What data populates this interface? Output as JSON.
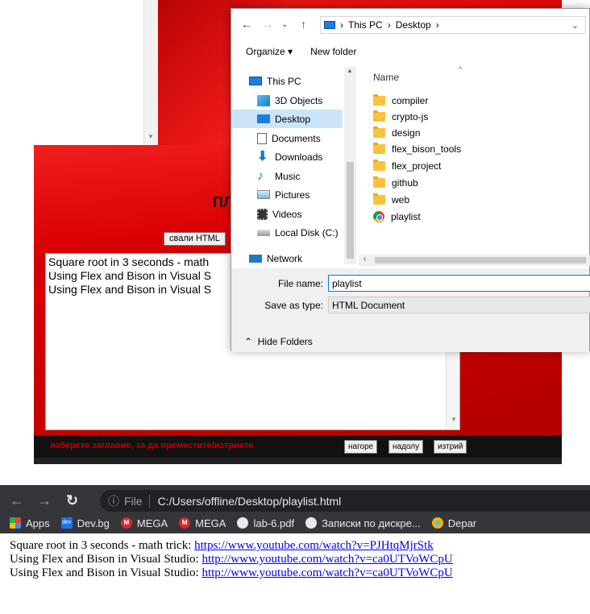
{
  "app": {
    "title_fragment": "ПЛ",
    "load_html_button": "свали HTML",
    "textarea_lines": [
      "Square root in 3 seconds - math",
      "Using Flex and Bison in Visual S",
      "Using Flex and Bison in Visual S"
    ],
    "footer_hint": "изберете заглавие, за да преместите/изтриете",
    "buttons": {
      "up": "нагоре",
      "down": "надолу",
      "delete": "изтрий"
    }
  },
  "dialog": {
    "breadcrumb": [
      "This PC",
      "Desktop"
    ],
    "toolbar": {
      "organize": "Organize ▾",
      "new_folder": "New folder"
    },
    "nav_items": [
      {
        "label": "This PC",
        "icon": "pc-icon",
        "selected": false
      },
      {
        "label": "3D Objects",
        "icon": "cube-icon",
        "selected": false
      },
      {
        "label": "Desktop",
        "icon": "desktop-icon",
        "selected": true
      },
      {
        "label": "Documents",
        "icon": "document-icon",
        "selected": false
      },
      {
        "label": "Downloads",
        "icon": "download-icon",
        "selected": false
      },
      {
        "label": "Music",
        "icon": "music-icon",
        "selected": false
      },
      {
        "label": "Pictures",
        "icon": "pictures-icon",
        "selected": false
      },
      {
        "label": "Videos",
        "icon": "video-icon",
        "selected": false
      },
      {
        "label": "Local Disk (C:)",
        "icon": "disk-icon",
        "selected": false
      },
      {
        "label": "Network",
        "icon": "network-icon",
        "selected": false
      }
    ],
    "column_header": "Name",
    "files": [
      {
        "name": "compiler",
        "type": "folder"
      },
      {
        "name": "crypto-js",
        "type": "folder"
      },
      {
        "name": "design",
        "type": "folder"
      },
      {
        "name": "flex_bison_tools",
        "type": "folder"
      },
      {
        "name": "flex_project",
        "type": "folder"
      },
      {
        "name": "github",
        "type": "folder"
      },
      {
        "name": "web",
        "type": "folder"
      },
      {
        "name": "playlist",
        "type": "chrome"
      }
    ],
    "file_name_label": "File name:",
    "file_name_value": "playlist",
    "save_as_label": "Save as type:",
    "save_as_value": "HTML Document",
    "hide_folders": "Hide Folders"
  },
  "browser": {
    "file_label": "File",
    "url": "C:/Users/offline/Desktop/playlist.html",
    "bookmarks": [
      {
        "label": "Apps",
        "color": "#ea4335"
      },
      {
        "label": "Dev.bg",
        "color": "#1a73e8"
      },
      {
        "label": "MEGA",
        "color": "#d9272e"
      },
      {
        "label": "MEGA",
        "color": "#d9272e"
      },
      {
        "label": "lab-6.pdf",
        "color": "#e8eaed"
      },
      {
        "label": "Записки по дискре...",
        "color": "#e8eaed"
      },
      {
        "label": "Depar",
        "color": "#f4b400"
      }
    ],
    "lines": [
      {
        "text": "Square root in 3 seconds - math trick: ",
        "link": "https://www.youtube.com/watch?v=PJHtqMjrStk"
      },
      {
        "text": "Using Flex and Bison in Visual Studio: ",
        "link": "http://www.youtube.com/watch?v=ca0UTVoWCpU"
      },
      {
        "text": "Using Flex and Bison in Visual Studio: ",
        "link": "http://www.youtube.com/watch?v=ca0UTVoWCpU"
      }
    ]
  }
}
